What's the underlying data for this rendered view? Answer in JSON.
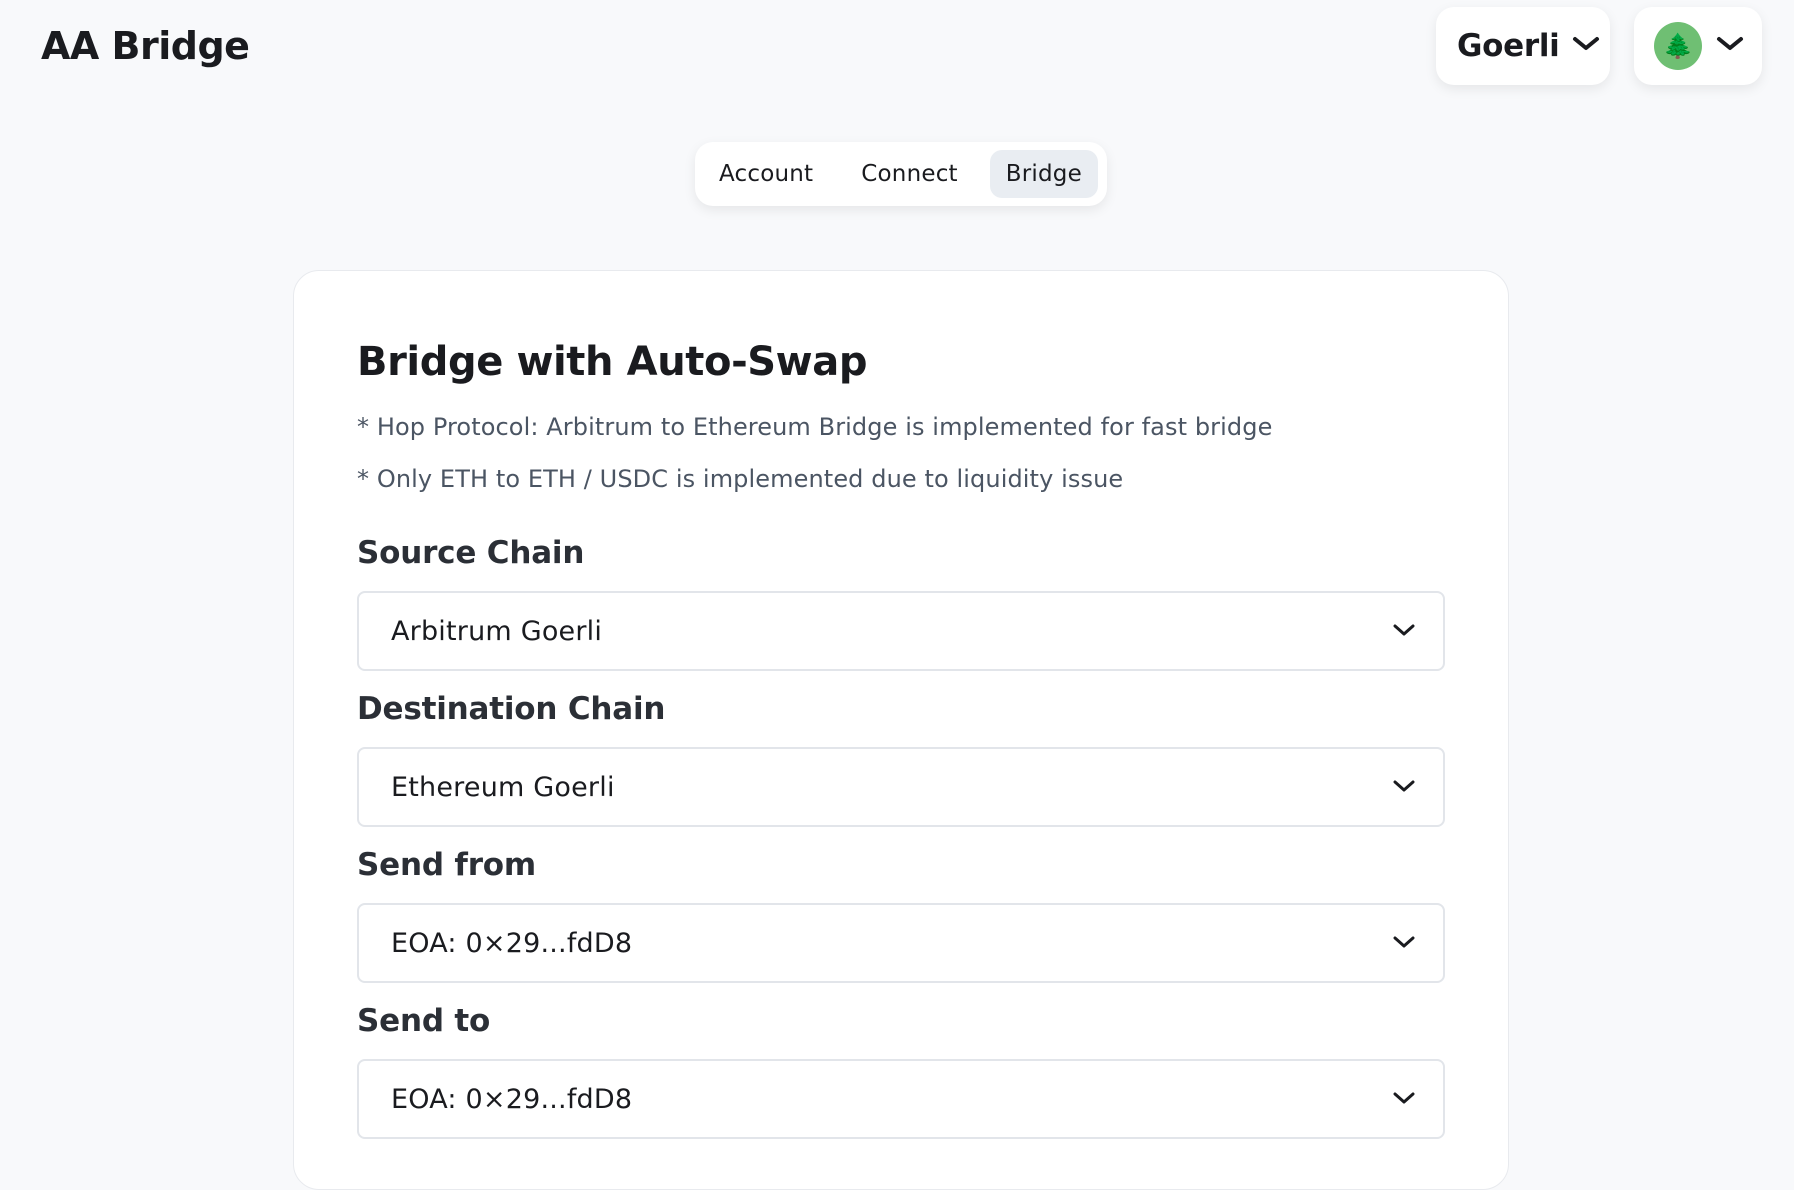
{
  "app": {
    "title": "AA Bridge"
  },
  "header": {
    "network_label": "Goerli",
    "network_chevron_icon": "chevron-down-icon",
    "account_avatar_icon": "tree-icon",
    "account_avatar_glyph": "🌲",
    "account_chevron_icon": "chevron-down-icon",
    "avatar_color": "#6fbf73"
  },
  "tabs": [
    {
      "label": "Account",
      "active": false
    },
    {
      "label": "Connect",
      "active": false
    },
    {
      "label": "Bridge",
      "active": true
    }
  ],
  "card": {
    "title": "Bridge with Auto-Swap",
    "notes": [
      "* Hop Protocol: Arbitrum to Ethereum Bridge is implemented for fast bridge",
      "* Only ETH to ETH / USDC is implemented due to liquidity issue"
    ],
    "fields": [
      {
        "label": "Source Chain",
        "value": "Arbitrum Goerli"
      },
      {
        "label": "Destination Chain",
        "value": "Ethereum Goerli"
      },
      {
        "label": "Send from",
        "value": "EOA: 0×29...fdD8"
      },
      {
        "label": "Send to",
        "value": "EOA: 0×29...fdD8"
      }
    ]
  }
}
